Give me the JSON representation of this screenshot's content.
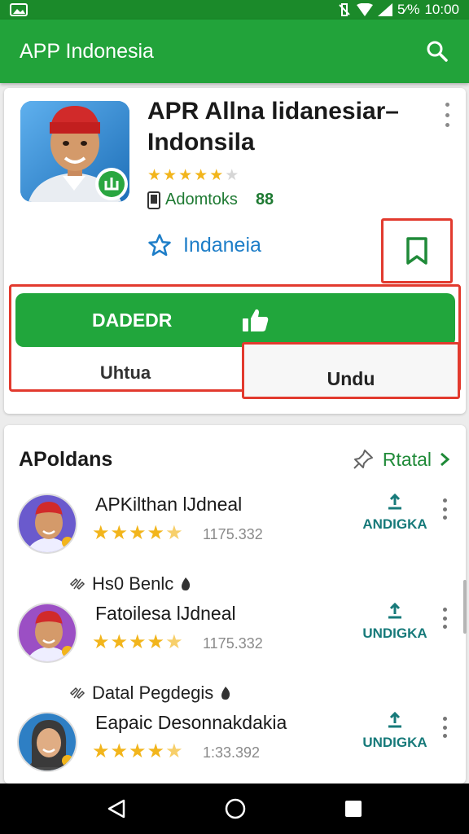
{
  "status_bar": {
    "percent": "5⁄%",
    "time": "10:00"
  },
  "app_bar": {
    "title": "APP Indonesia"
  },
  "app": {
    "name": "APR Allna lidanesiar– Indonsila",
    "rating": 4.5,
    "developer": "Adomtoks",
    "dev_count": "88",
    "wishlist_label": "Indaneia",
    "install_label": "DADEDR",
    "sub_left_label": "Uhtua",
    "sub_right_label": "Undu"
  },
  "section": {
    "title": "APoldans",
    "link_label": "Rtatal"
  },
  "list": [
    {
      "tag": "",
      "name": "APKilthan lJdneal",
      "count": "1175.332",
      "action": "ANDIGKA",
      "avatar_bg": "#6a5acd"
    },
    {
      "tag": "Hs0 Benlc",
      "name": "Fatoilesa lJdneal",
      "count": "1175.332",
      "action": "UNDIGKA",
      "avatar_bg": "#9b4fc4"
    },
    {
      "tag": "Datal Pegdegis",
      "name": "Eapaic Desonnakdakia",
      "count": "1:33.392",
      "action": "UNDIGKA",
      "avatar_bg": "#2e7fc4"
    }
  ],
  "colors": {
    "primary": "#22a33a",
    "status": "#1b8a2a",
    "highlight": "#e23a2e",
    "star": "#f2b51c",
    "teal": "#177a7a",
    "blue": "#1e7ec8"
  },
  "icons": {
    "search": "search-icon",
    "bookmark": "bookmark-icon",
    "star_outline": "star-outline-icon",
    "thumb": "thumbs-up-icon",
    "back": "back-icon",
    "home": "home-icon",
    "recents": "recents-icon"
  }
}
